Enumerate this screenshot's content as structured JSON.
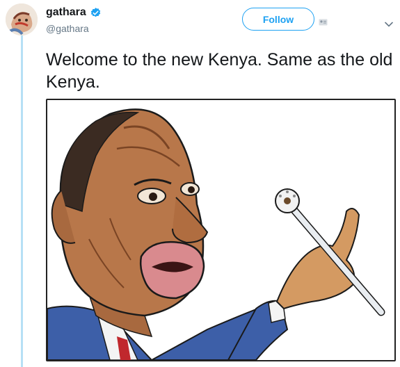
{
  "tweet": {
    "author": {
      "display_name": "gathara",
      "handle": "@gathara",
      "verified": true
    },
    "follow_label": "Follow",
    "text": "Welcome to the new Kenya. Same as the old Kenya."
  },
  "icons": {
    "verified": "verified-badge-icon",
    "follow": "follow-person-icon",
    "menu": "chevron-down-icon"
  },
  "colors": {
    "accent": "#1da1f2",
    "thread_line": "#b6e0f5",
    "text_primary": "#14171a",
    "text_secondary": "#657786"
  }
}
